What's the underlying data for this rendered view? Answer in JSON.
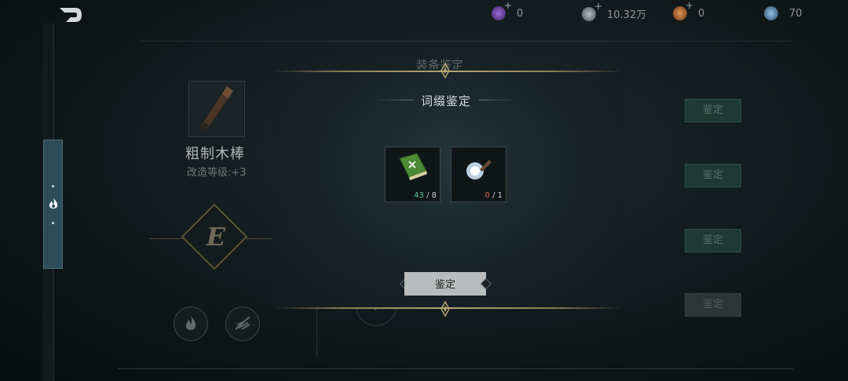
{
  "top_bar": {
    "currencies": [
      {
        "icon": "purple-gem-icon",
        "color": "#7a4bbf",
        "value": "0"
      },
      {
        "icon": "silver-coin-icon",
        "color": "#8c9396",
        "value": "10.32万"
      },
      {
        "icon": "orange-coin-icon",
        "color": "#c2703a",
        "value": "0"
      },
      {
        "icon": "blue-crystal-icon",
        "color": "#5f8fb6",
        "value": "70"
      }
    ]
  },
  "background_panel": {
    "title": "装备鉴定",
    "item_name": "粗制木棒",
    "upgrade_level": "改造等级:+3",
    "rank_letter": "E",
    "slot_placeholder": "?",
    "side_buttons": [
      "鉴定",
      "鉴定",
      "鉴定",
      "鉴定"
    ]
  },
  "modal": {
    "title": "词缀鉴定",
    "materials": [
      {
        "icon": "green-book-icon",
        "have": "43",
        "sep": "/",
        "need": "8"
      },
      {
        "icon": "blue-orb-wand-icon",
        "have": "0",
        "sep": "/",
        "need": "1"
      }
    ],
    "confirm_label": "鉴定"
  },
  "colors": {
    "accent_gold": "#b7a571",
    "ok_green": "#59c79a",
    "bad_red": "#e0665b",
    "side_button_green": "#1e3a32"
  }
}
